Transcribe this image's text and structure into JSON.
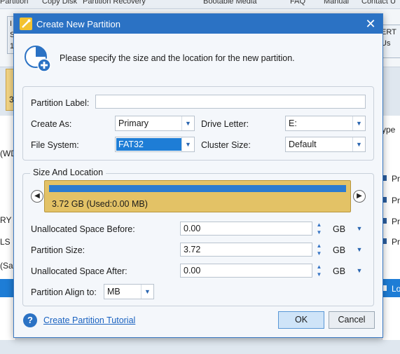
{
  "background": {
    "top_items": [
      "Partition",
      "Copy Disk",
      "Partition Recovery",
      "Bootable Media",
      "FAQ",
      "Manual",
      "Contact U"
    ],
    "toolbar_fragments": [
      "I",
      "S",
      "1",
      "ERT",
      "Us"
    ],
    "left_fragments": [
      "3",
      "(WD",
      "RY",
      "LS",
      "(Sa"
    ],
    "right_fragments": [
      "ype",
      "Pr",
      "Pr",
      "Pr",
      "Pr",
      "Lo"
    ]
  },
  "dialog": {
    "title": "Create New Partition",
    "close_glyph": "✕",
    "instruction": "Please specify the size and the location for the new partition.",
    "partition_label": {
      "label": "Partition Label:",
      "value": ""
    },
    "create_as": {
      "label": "Create As:",
      "value": "Primary"
    },
    "drive_letter": {
      "label": "Drive Letter:",
      "value": "E:"
    },
    "file_system": {
      "label": "File System:",
      "value": "FAT32"
    },
    "cluster_size": {
      "label": "Cluster Size:",
      "value": "Default"
    },
    "size_location": {
      "legend": "Size And Location",
      "bar_caption": "3.72 GB (Used:0.00 MB)",
      "unallocated_before": {
        "label": "Unallocated Space Before:",
        "value": "0.00",
        "unit": "GB"
      },
      "partition_size": {
        "label": "Partition Size:",
        "value": "3.72",
        "unit": "GB"
      },
      "unallocated_after": {
        "label": "Unallocated Space After:",
        "value": "0.00",
        "unit": "GB"
      },
      "align": {
        "label": "Partition Align to:",
        "value": "MB"
      }
    },
    "tutorial_link": "Create Partition Tutorial",
    "help_glyph": "?",
    "ok_label": "OK",
    "cancel_label": "Cancel"
  },
  "colors": {
    "titlebar": "#2b72c4",
    "partition_bar": "#e3c266",
    "used_fill": "#2b7bd0",
    "selection": "#1e7dd6"
  }
}
